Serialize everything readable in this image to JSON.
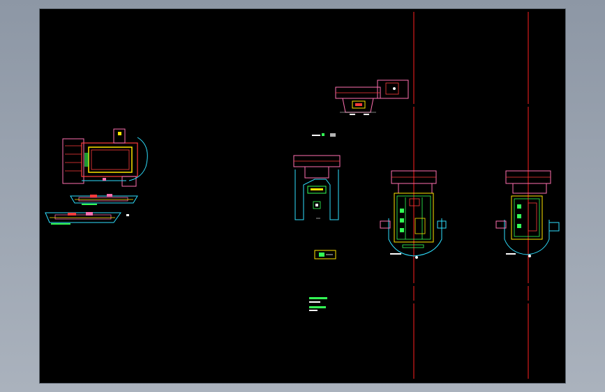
{
  "viewer": {
    "background_top": "#8d97a5",
    "background_bottom": "#aab2bd"
  },
  "sheet": {
    "background": "#000000"
  },
  "palette": {
    "red": "#ff3b3b",
    "pink": "#ff6fb0",
    "cyan": "#2fe0ff",
    "yellow": "#ffe600",
    "green": "#33ff55",
    "white": "#ffffff",
    "axis": "#ff2020"
  },
  "drawings": [
    {
      "id": "plan-left",
      "kind": "floor-plan"
    },
    {
      "id": "section-left-1",
      "kind": "elevation-strip"
    },
    {
      "id": "section-left-2",
      "kind": "elevation-strip"
    },
    {
      "id": "plan-top-center",
      "kind": "floor-plan"
    },
    {
      "id": "plan-middle",
      "kind": "floor-plan"
    },
    {
      "id": "plan-right-1",
      "kind": "floor-plan"
    },
    {
      "id": "plan-right-2",
      "kind": "floor-plan"
    },
    {
      "id": "legend-box",
      "kind": "detail"
    },
    {
      "id": "notes-block",
      "kind": "text-block"
    }
  ]
}
